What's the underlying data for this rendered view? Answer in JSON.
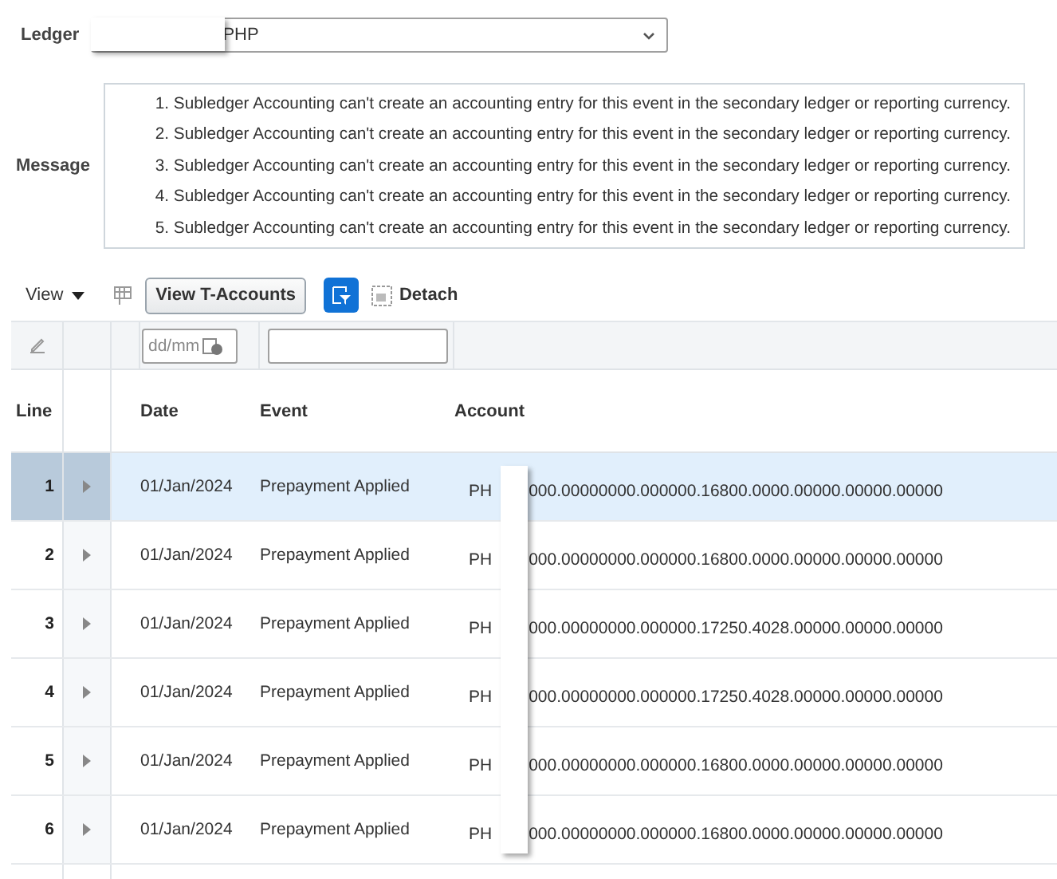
{
  "ledger": {
    "label": "Ledger",
    "value": "PHP"
  },
  "message": {
    "label": "Message",
    "lines": [
      "1. Subledger Accounting can't create an accounting entry for this event in the secondary ledger or reporting currency.",
      "2. Subledger Accounting can't create an accounting entry for this event in the secondary ledger or reporting currency.",
      "3. Subledger Accounting can't create an accounting entry for this event in the secondary ledger or reporting currency.",
      "4. Subledger Accounting can't create an accounting entry for this event in the secondary ledger or reporting currency.",
      "5. Subledger Accounting can't create an accounting entry for this event in the secondary ledger or reporting currency."
    ]
  },
  "toolbar": {
    "view_menu": "View",
    "button": "View T-Accounts",
    "detach": "Detach"
  },
  "table": {
    "filter": {
      "date_placeholder": "dd/mm"
    },
    "columns": [
      "Line",
      "Date",
      "Event",
      "Account"
    ],
    "rows": [
      {
        "line": "1",
        "date": "01/Jan/2024",
        "event": "Prepayment Applied",
        "account_prefix": "PH",
        "account_rest": "000.00000000.000000.16800.0000.00000.00000.00000",
        "selected": true
      },
      {
        "line": "2",
        "date": "01/Jan/2024",
        "event": "Prepayment Applied",
        "account_prefix": "PH",
        "account_rest": "000.00000000.000000.16800.0000.00000.00000.00000",
        "selected": false
      },
      {
        "line": "3",
        "date": "01/Jan/2024",
        "event": "Prepayment Applied",
        "account_prefix": "PH",
        "account_rest": "000.00000000.000000.17250.4028.00000.00000.00000",
        "selected": false
      },
      {
        "line": "4",
        "date": "01/Jan/2024",
        "event": "Prepayment Applied",
        "account_prefix": "PH",
        "account_rest": "000.00000000.000000.17250.4028.00000.00000.00000",
        "selected": false
      },
      {
        "line": "5",
        "date": "01/Jan/2024",
        "event": "Prepayment Applied",
        "account_prefix": "PH",
        "account_rest": "000.00000000.000000.16800.0000.00000.00000.00000",
        "selected": false
      },
      {
        "line": "6",
        "date": "01/Jan/2024",
        "event": "Prepayment Applied",
        "account_prefix": "PH",
        "account_rest": "000.00000000.000000.16800.0000.00000.00000.00000",
        "selected": false
      }
    ]
  }
}
